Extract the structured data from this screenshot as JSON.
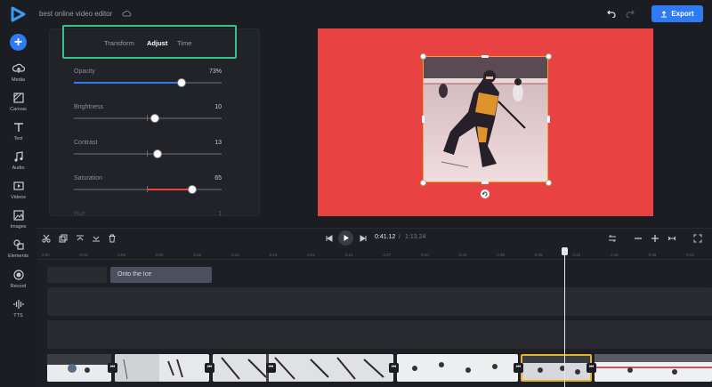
{
  "app": {
    "project_title": "best online video editor",
    "export_label": "Export"
  },
  "rail": [
    {
      "label": "Media",
      "icon": "media-icon"
    },
    {
      "label": "Canvas",
      "icon": "canvas-icon"
    },
    {
      "label": "Text",
      "icon": "text-icon"
    },
    {
      "label": "Audio",
      "icon": "audio-icon"
    },
    {
      "label": "Videos",
      "icon": "videos-icon"
    },
    {
      "label": "Images",
      "icon": "images-icon"
    },
    {
      "label": "Elements",
      "icon": "elements-icon"
    },
    {
      "label": "Record",
      "icon": "record-icon"
    },
    {
      "label": "TTS",
      "icon": "tts-icon"
    }
  ],
  "panel": {
    "tabs": [
      "Transform",
      "Adjust",
      "Time"
    ],
    "active_tab": "Adjust",
    "sliders": [
      {
        "name": "Opacity",
        "value": "73%",
        "level": 0.73,
        "color": "#2f7bf6"
      },
      {
        "name": "Brightness",
        "value": "10",
        "level": 0.55
      },
      {
        "name": "Contrast",
        "value": "13",
        "level": 0.565
      },
      {
        "name": "Saturation",
        "value": "65",
        "level": 0.8,
        "color": "#e84242"
      },
      {
        "name": "Hue",
        "value": "1"
      }
    ]
  },
  "timeline": {
    "current_time": "0:41.12",
    "separator": "/",
    "total_time": "1:13.24",
    "ruler": [
      "0:00",
      "0:03",
      "0:06",
      "0:09",
      "0:12",
      "0:15",
      "0:18",
      "0:21",
      "0:24",
      "0:27",
      "0:30",
      "0:33",
      "0:36",
      "0:39",
      "0:42",
      "0:45",
      "0:48",
      "0:51"
    ],
    "text_clip": "Onto the Ice"
  },
  "colors": {
    "accent": "#2f7bf6",
    "canvas_bg": "#e84242",
    "highlight": "#34c28b",
    "selected_clip": "#e6b322"
  }
}
